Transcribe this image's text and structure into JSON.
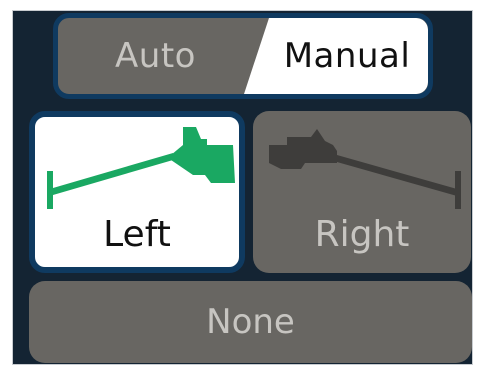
{
  "mode_toggle": {
    "options": [
      {
        "label": "Auto",
        "selected": false
      },
      {
        "label": "Manual",
        "selected": true
      }
    ]
  },
  "direction": {
    "left_label": "Left",
    "right_label": "Right",
    "none_label": "None",
    "selected": "Left",
    "icons": {
      "left": "boat-heading-left-icon",
      "right": "boat-heading-right-icon"
    }
  },
  "colors": {
    "selected_icon": "#1aa862",
    "unselected_icon": "#3e3d3b",
    "selection_border": "#0f3a60"
  }
}
